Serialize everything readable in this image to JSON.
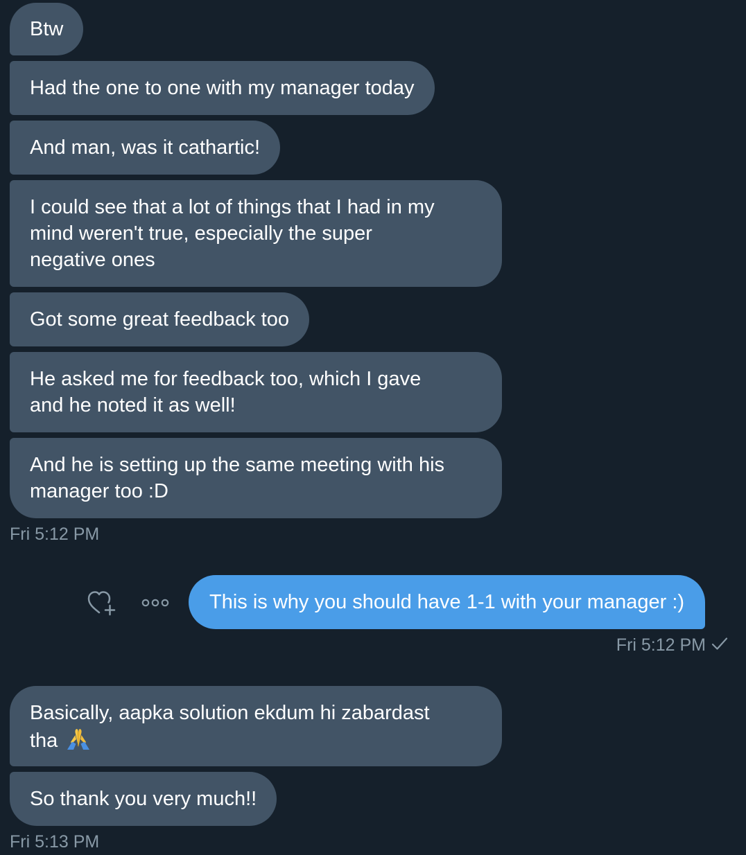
{
  "thread": {
    "incoming_group_1": [
      {
        "lines": [
          "Btw"
        ]
      },
      {
        "lines": [
          "Had the one to one with my manager today"
        ]
      },
      {
        "lines": [
          "And man, was it cathartic!"
        ]
      },
      {
        "lines": [
          "I could see that a lot of things that I had in my",
          "mind weren't true, especially the super",
          "negative ones"
        ]
      },
      {
        "lines": [
          "Got some great feedback too"
        ]
      },
      {
        "lines": [
          "He asked me for feedback too, which I gave",
          "and he noted it as well!"
        ]
      },
      {
        "lines": [
          "And he is setting up the same meeting with his",
          "manager too :D"
        ]
      }
    ],
    "incoming_group_1_time": "Fri 5:12 PM",
    "outgoing": {
      "text": "This is why you should have 1-1 with your manager :)",
      "time": "Fri 5:12 PM",
      "status_icon": "checkmark-icon",
      "actions": [
        "add-reaction-icon",
        "more-options-icon"
      ]
    },
    "incoming_group_2": [
      {
        "lines": [
          "Basically, aapka solution ekdum hi zabardast",
          "tha"
        ],
        "trailing_icon": "folded-hands-emoji"
      },
      {
        "lines": [
          "So thank you very much!!"
        ]
      }
    ],
    "incoming_group_2_time": "Fri 5:13 PM"
  },
  "colors": {
    "background": "#15202b",
    "incoming_bubble": "#425466",
    "outgoing_bubble": "#4a9de8",
    "timestamp": "#8899a6",
    "text": "#ffffff"
  }
}
